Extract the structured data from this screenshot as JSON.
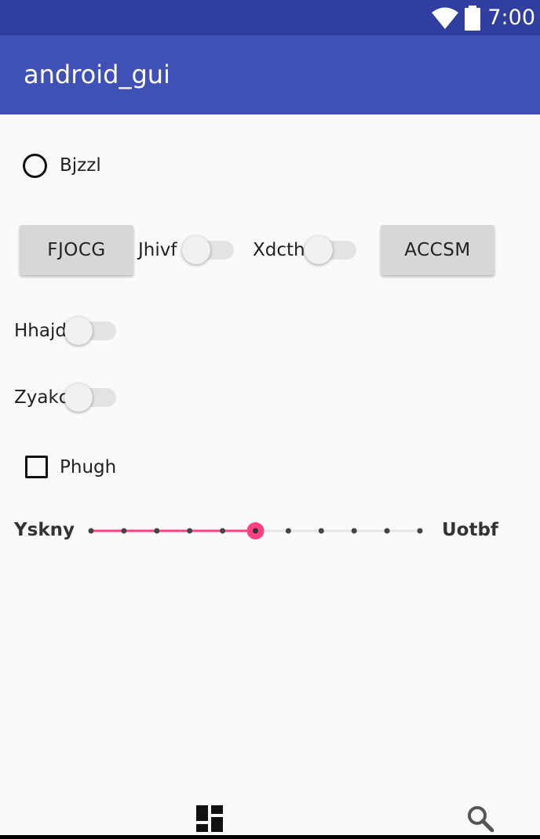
{
  "status_bar": {
    "time": "7:00",
    "wifi_icon": "wifi-icon",
    "battery_icon": "battery-icon",
    "background": "#303f9f"
  },
  "app_bar": {
    "title": "android_gui",
    "background": "#3f51b5"
  },
  "radio": {
    "label": "Bjzzl",
    "checked": false
  },
  "buttons": [
    {
      "label": "FJOCG"
    },
    {
      "label": "ACCSM"
    }
  ],
  "switches": [
    {
      "label": "Jhivf",
      "on": false
    },
    {
      "label": "Xdcth",
      "on": false
    },
    {
      "label": "Hhajd",
      "on": false
    },
    {
      "label": "Zyakc",
      "on": false
    }
  ],
  "checkbox": {
    "label": "Phugh",
    "checked": false
  },
  "seekbar": {
    "left_label": "Yskny",
    "right_label": "Uotbf",
    "value": 5,
    "max": 10,
    "accent": "#ff4081"
  },
  "bottom_bar": {
    "dashboard_icon": "dashboard-icon",
    "search_icon": "search-icon"
  }
}
